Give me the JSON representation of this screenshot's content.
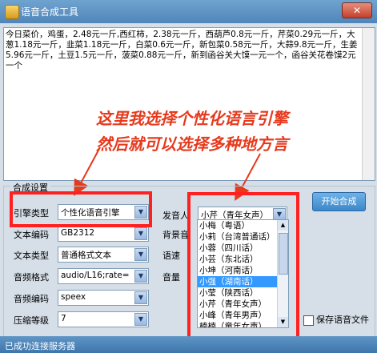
{
  "window": {
    "title": "语音合成工具",
    "close_label": "✕"
  },
  "text_input": {
    "value": "今日菜价，鸡蛋，2.48元一斤,西红柿，2.38元一斤，西葫芦0.8元一斤，芹菜0.29元一斤，大葱1.18元一斤，韭菜1.18元一斤，白菜0.6元一斤，新包菜0.58元一斤，大蒜9.8元一斤，生姜5.96元一斤，土豆1.5元一斤，菠菜0.88元一斤，新到函谷关大馍一元一个，函谷关花卷馍2元一个"
  },
  "annotation": {
    "line1": "这里我选择个性化语言引擎",
    "line2": "然后就可以选择多种地方言"
  },
  "settings": {
    "group_title": "合成设置",
    "engine_type_label": "引擎类型",
    "engine_type_value": "个性化语音引擎",
    "text_encoding_label": "文本编码",
    "text_encoding_value": "GB2312",
    "text_type_label": "文本类型",
    "text_type_value": "普通格式文本",
    "audio_format_label": "音频格式",
    "audio_format_value": "audio/L16;rate=",
    "audio_encoding_label": "音频编码",
    "audio_encoding_value": "speex",
    "compression_label": "压缩等级",
    "compression_value": "7",
    "speaker_label": "发音人",
    "speaker_value": "小芹（青年女声）",
    "bg_label": "背景音",
    "speed_label": "语速",
    "volume_label": "音量"
  },
  "speaker_options": [
    "小梅（粤语）",
    "小莉（台湾普通话）",
    "小蓉（四川话）",
    "小芸（东北话）",
    "小坤（河南话）",
    "小强（湖南话）",
    "小莹（陕西话）",
    "小芹（青年女声）",
    "小峰（青年男声）",
    "楠楠（童年女声）"
  ],
  "selected_option_index": 5,
  "start_button_label": "开始合成",
  "save_audio_label": "保存语音文件",
  "status_text": "已成功连接服务器",
  "colors": {
    "annotation": "#e63a1e",
    "highlight_box": "#ff2020",
    "selection": "#3399ff"
  }
}
